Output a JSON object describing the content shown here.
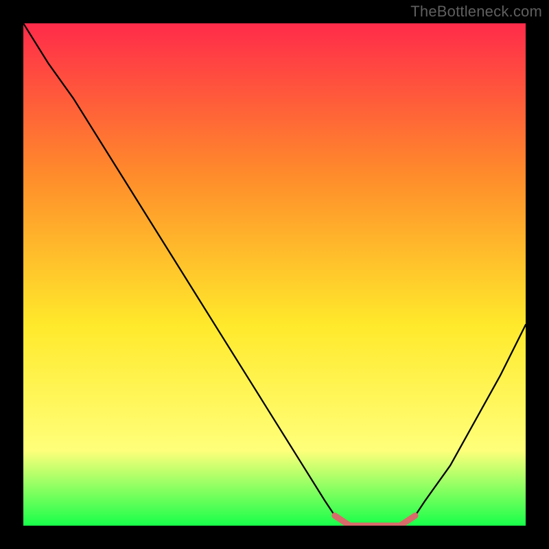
{
  "watermark": "TheBottleneck.com",
  "chart_data": {
    "type": "line",
    "title": "",
    "xlabel": "",
    "ylabel": "",
    "xlim": [
      0,
      100
    ],
    "ylim": [
      0,
      100
    ],
    "grid": false,
    "legend": false,
    "background_gradient": {
      "top": "#ff2b4a",
      "mid_upper": "#ff8b2b",
      "mid": "#ffe92b",
      "lower": "#ffff7a",
      "bottom": "#18ff4a"
    },
    "series": [
      {
        "name": "curve",
        "color": "#000000",
        "x": [
          0,
          5,
          10,
          15,
          20,
          25,
          30,
          35,
          40,
          45,
          50,
          55,
          60,
          62,
          65,
          70,
          75,
          78,
          80,
          85,
          90,
          95,
          100
        ],
        "y": [
          100,
          92,
          85,
          77,
          69,
          61,
          53,
          45,
          37,
          29,
          21,
          13,
          5,
          2,
          0,
          0,
          0,
          2,
          5,
          12,
          21,
          30,
          40
        ]
      },
      {
        "name": "flat_highlight",
        "color": "#d86a6a",
        "x": [
          62,
          65,
          70,
          75,
          78
        ],
        "y": [
          2,
          0,
          0,
          0,
          2
        ]
      }
    ]
  }
}
